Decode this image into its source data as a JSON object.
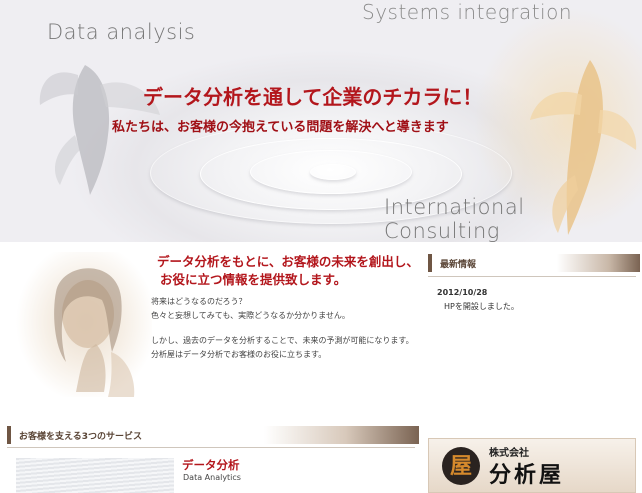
{
  "hero": {
    "word_data": "Data analysis",
    "word_systems": "Systems integration",
    "word_international": "International Consulting",
    "title": "データ分析を通して企業のチカラに！",
    "subtitle": "私たちは、お客様の今抱えている問題を解決へと導きます"
  },
  "intro": {
    "heading_line1": "データ分析をもとに、お客様の未来を創出し、",
    "heading_line2": "お役に立つ情報を提供致します。",
    "paragraphs": [
      "将来はどうなるのだろう？",
      "色々と妄想してみても、実際どうなるか分かりません。",
      "しかし、過去のデータを分析することで、未来の予測が可能になります。",
      "分析屋はデータ分析でお客様のお役に立ちます。"
    ]
  },
  "news": {
    "heading": "最新情報",
    "items": [
      {
        "date": "2012/10/28",
        "text": "HPを開設しました。"
      }
    ]
  },
  "services": {
    "heading": "お客様を支える3つのサービス",
    "items": [
      {
        "title": "データ分析",
        "subtitle": "Data Analytics"
      }
    ]
  },
  "company": {
    "logo_char": "屋",
    "prefix": "株式会社",
    "name": "分析屋"
  },
  "colors": {
    "accent_red": "#b3161c",
    "heading_brown": "#6f5644"
  }
}
